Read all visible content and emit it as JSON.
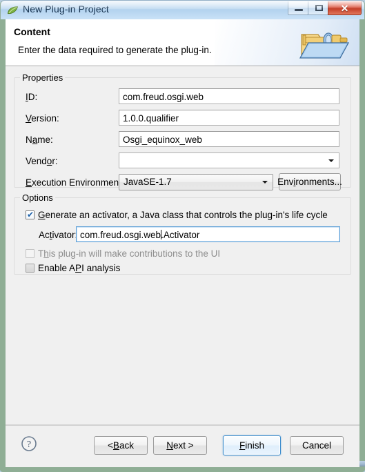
{
  "window": {
    "title": "New Plug-in Project",
    "app_icon": "eclipse-leaf-icon",
    "minimize_label": "—",
    "maximize_label": "□",
    "close_label": "✕"
  },
  "header": {
    "title": "Content",
    "description": "Enter the data required to generate the plug-in.",
    "banner_icon": "plugin-connector-folder-icon"
  },
  "properties": {
    "group_label": "Properties",
    "fields": [
      {
        "label_pre": "",
        "label_mn": "I",
        "label_post": "D:",
        "value": "com.freud.osgi.web",
        "placeholder": ""
      },
      {
        "label_pre": "",
        "label_mn": "V",
        "label_post": "ersion:",
        "value": "1.0.0.qualifier",
        "placeholder": ""
      },
      {
        "label_pre": "N",
        "label_mn": "a",
        "label_post": "me:",
        "value": "Osgi_equinox_web",
        "placeholder": ""
      },
      {
        "label_pre": "Vend",
        "label_mn": "o",
        "label_post": "r:",
        "value": "",
        "placeholder": ""
      }
    ],
    "execution_environment": {
      "label_pre": "",
      "label_mn": "E",
      "label_post": "xecution Environment:",
      "value": "JavaSE-1.7",
      "button_pre": "Env",
      "button_mn": "i",
      "button_post": "ronments..."
    }
  },
  "options": {
    "group_label": "Options",
    "generate_activator": {
      "label_pre": "",
      "label_mn": "G",
      "label_post": "enerate an activator, a Java class that controls the plug-in's life cycle",
      "checked": true,
      "check_glyph": "✔"
    },
    "activator": {
      "label_pre": "Ac",
      "label_mn": "t",
      "label_post": "ivator:",
      "value_before_caret": "com.freud.osgi.web",
      "value_after_caret": ".Activator",
      "focused": true
    },
    "ui_contributions": {
      "label_pre": "T",
      "label_mn": "h",
      "label_post": "is plug-in will make contributions to the UI",
      "checked": false,
      "disabled": true
    },
    "api_analysis": {
      "label_pre": "Enable A",
      "label_mn": "P",
      "label_post": "I analysis",
      "checked": false,
      "disabled": false
    }
  },
  "buttonbar": {
    "help_icon": "question-mark-help-icon",
    "back": {
      "pre": "< ",
      "mn": "B",
      "post": "ack"
    },
    "next": {
      "pre": "",
      "mn": "N",
      "post": "ext >"
    },
    "finish": {
      "pre": "",
      "mn": "F",
      "post": "inish",
      "focused": true
    },
    "cancel": {
      "pre": "Cancel",
      "mn": "",
      "post": ""
    }
  },
  "colors": {
    "frame": "#8fae95",
    "titlebar": "#c3dcf2",
    "close_button": "#c23a24",
    "focus_blue": "#3c8ccd",
    "dialog_bg": "#f0f0f0",
    "header_bg": "#ffffff"
  }
}
